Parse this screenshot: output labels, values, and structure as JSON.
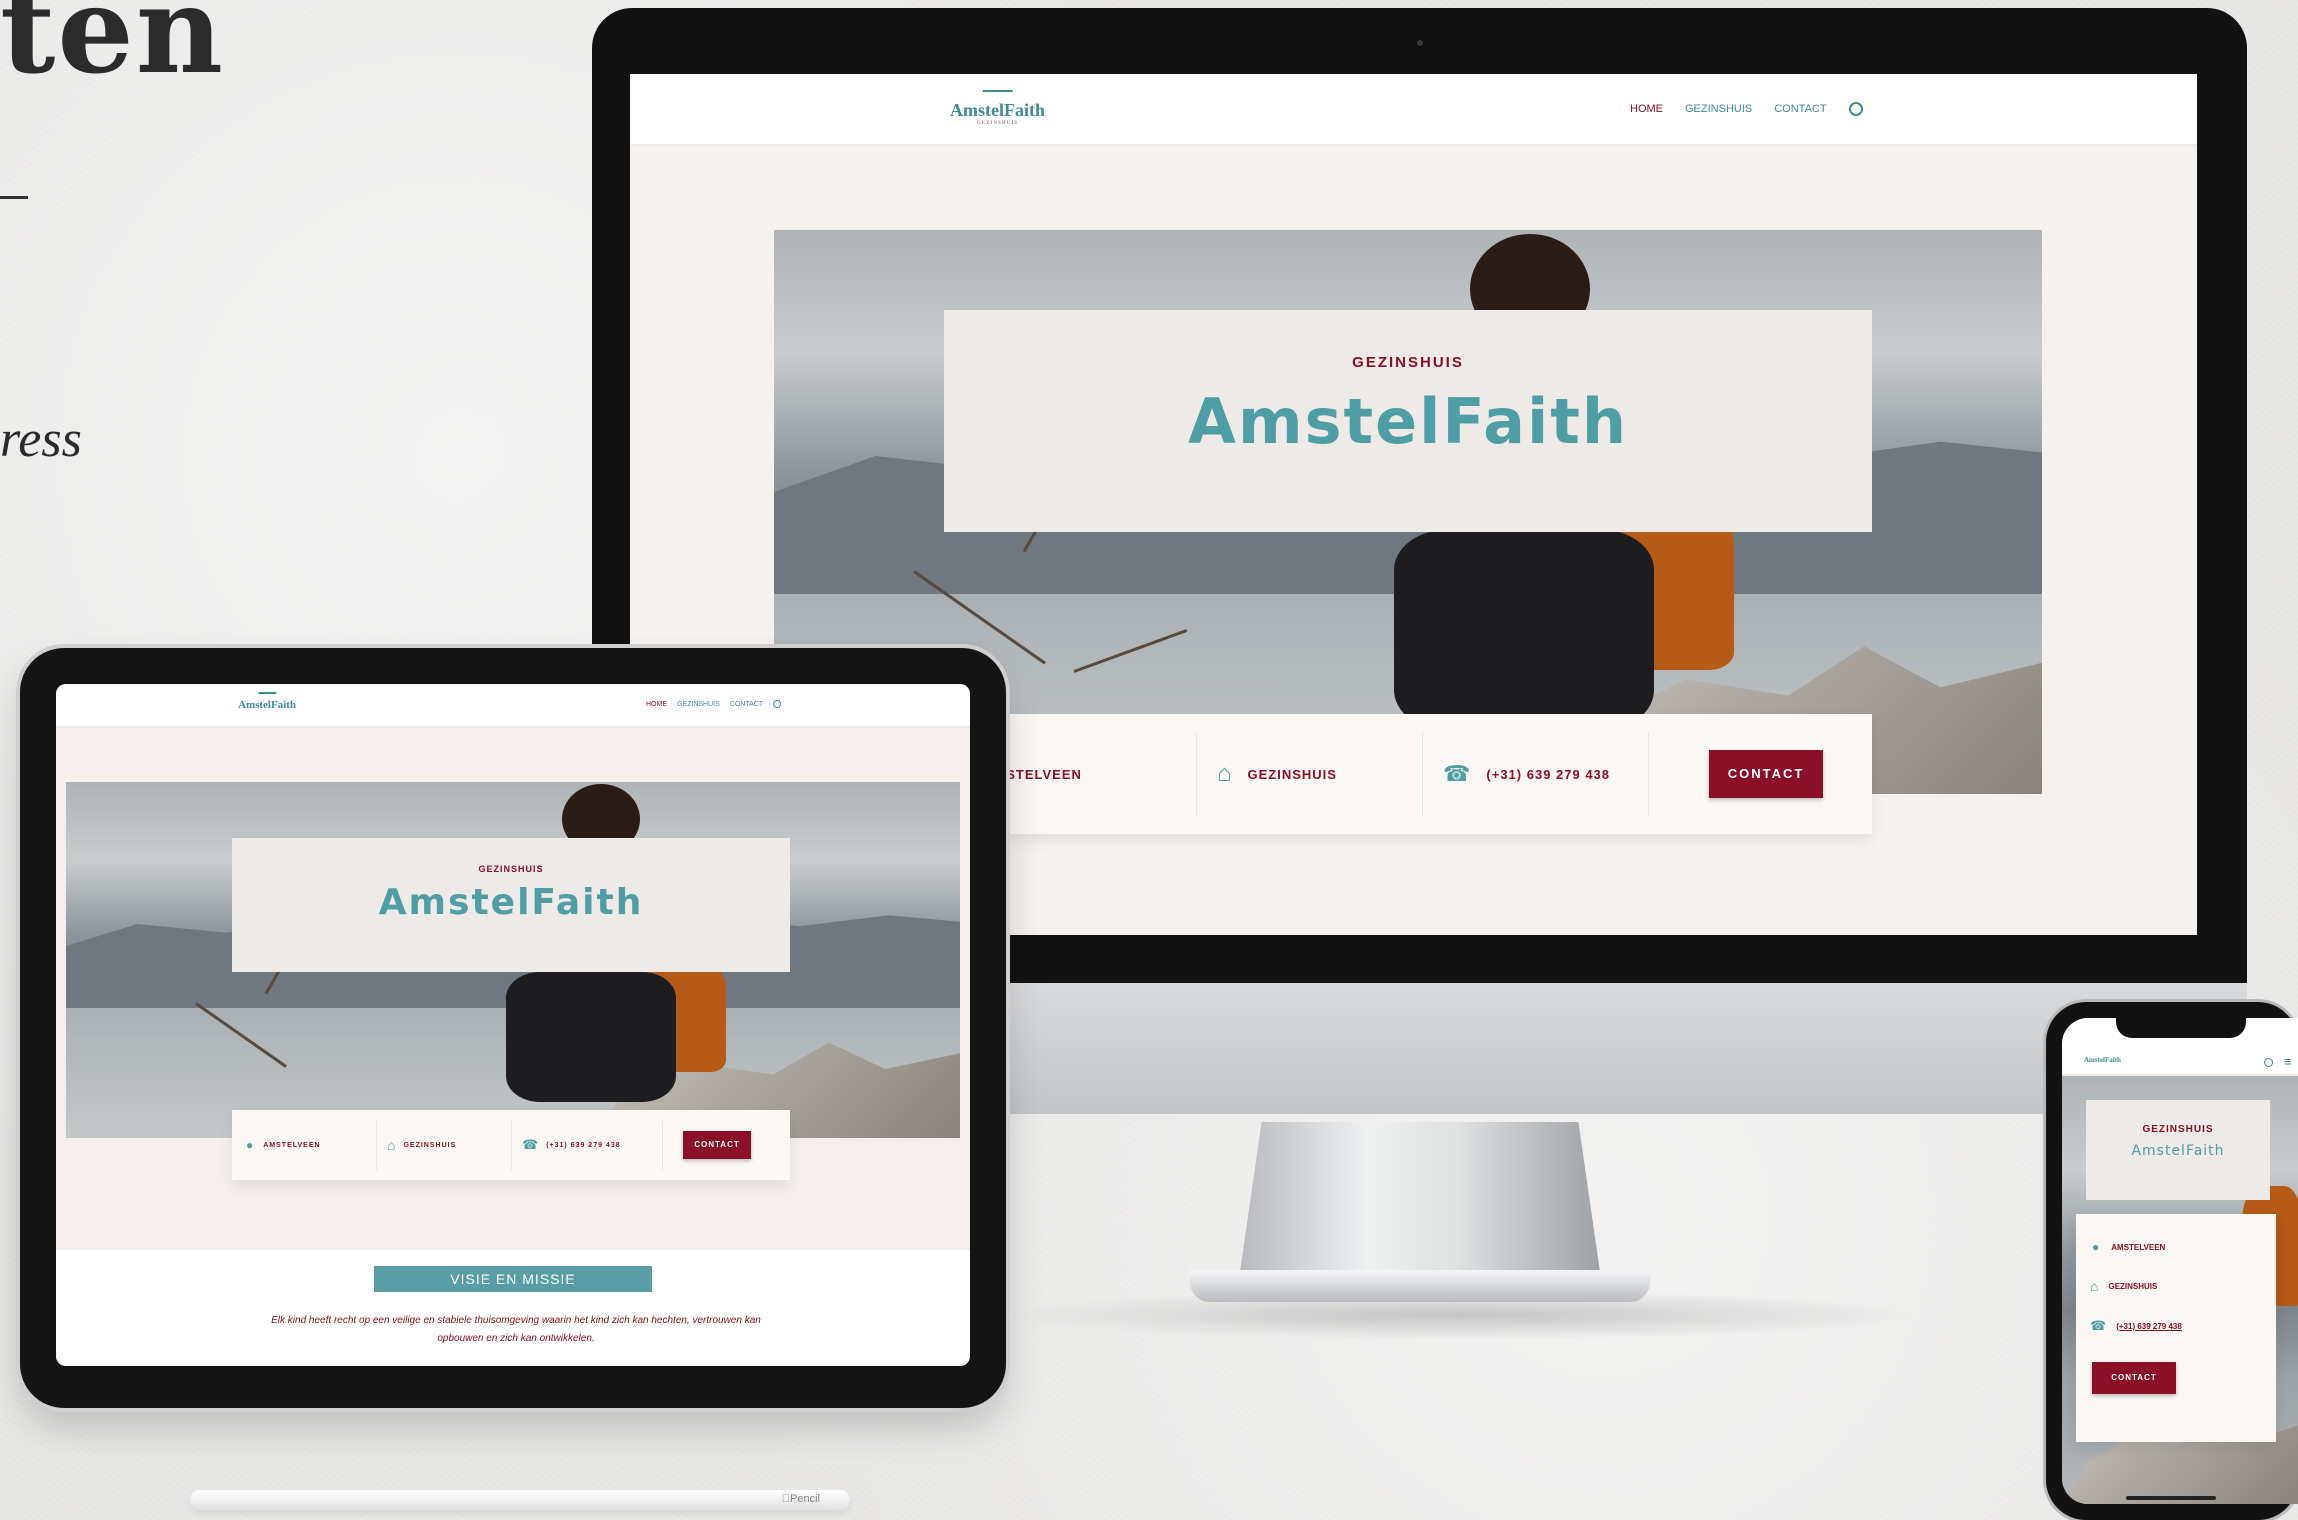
{
  "background": {
    "heading_fragment": "ten",
    "italic_fragment": "ress"
  },
  "colors": {
    "brand_teal": "#4f9ea6",
    "brand_red": "#8b0f26",
    "page_bg": "#f5f1ef"
  },
  "desktop": {
    "logo": "AmstelFaith",
    "logo_sub": "GEZINSHUIS",
    "nav": {
      "home": "HOME",
      "gezinshuis": "GEZINSHUIS",
      "contact": "CONTACT",
      "search_icon": "search-icon"
    },
    "hero": {
      "subtitle": "GEZINSHUIS",
      "title": "AmstelFaith"
    },
    "info": {
      "location": "AMSTELVEEN",
      "home": "GEZINSHUIS",
      "phone": "(+31) 639 279 438",
      "cta": "CONTACT"
    }
  },
  "tablet": {
    "logo": "AmstelFaith",
    "nav": {
      "home": "HOME",
      "gezinshuis": "GEZINSHUIS",
      "contact": "CONTACT"
    },
    "hero": {
      "subtitle": "GEZINSHUIS",
      "title": "AmstelFaith"
    },
    "info": {
      "location": "AMSTELVEEN",
      "home": "GEZINSHUIS",
      "phone": "(+31) 639 279 438",
      "cta": "CONTACT"
    },
    "section_title": "VISIE EN MISSIE",
    "section_text_1": "Elk kind heeft recht op een veilige en stabiele thuisomgeving waarin het kind zich kan hechten, vertrouwen kan",
    "section_text_2": "opbouwen en zich kan ontwikkelen."
  },
  "pencil": {
    "brand": "Pencil"
  },
  "phone": {
    "logo": "AmstelFaith",
    "hero": {
      "subtitle": "GEZINSHUIS",
      "title": "AmstelFaith"
    },
    "info": {
      "location": "AMSTELVEEN",
      "home": "GEZINSHUIS",
      "phone": "(+31) 639 279 438",
      "cta": "CONTACT"
    }
  }
}
